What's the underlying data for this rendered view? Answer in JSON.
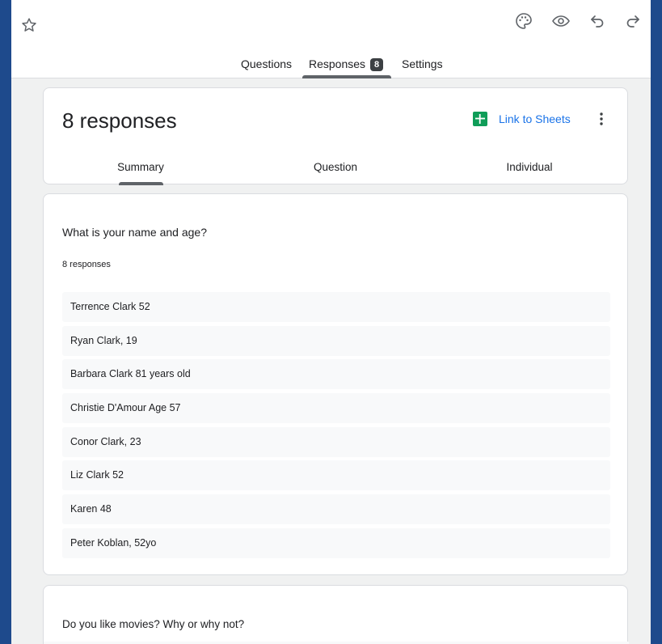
{
  "topbar": {
    "icons": [
      "star-icon",
      "palette-icon",
      "eye-icon",
      "undo-icon",
      "redo-icon"
    ],
    "tabs": [
      {
        "label": "Questions"
      },
      {
        "label": "Responses",
        "badge": "8"
      },
      {
        "label": "Settings"
      }
    ],
    "active_tab": "Responses"
  },
  "summary_header": {
    "response_count_label": "8 responses",
    "link_to_sheets_label": "Link to Sheets",
    "sub_tabs": [
      {
        "label": "Summary"
      },
      {
        "label": "Question"
      },
      {
        "label": "Individual"
      }
    ],
    "active_sub_tab": "Summary"
  },
  "question_1": {
    "title": "What is your name and age?",
    "count_label": "8 responses",
    "responses": [
      "Terrence Clark 52",
      "Ryan Clark, 19",
      "Barbara Clark 81 years old",
      "Christie D'Amour Age 57",
      "Conor Clark, 23",
      "Liz Clark 52",
      "Karen 48",
      "Peter Koblan, 52yo"
    ]
  },
  "question_2": {
    "title": "Do you like movies? Why or why not?"
  },
  "colors": {
    "page_bg": "#f0f1f1",
    "outer_bg": "#1e4a8c",
    "link_blue": "#1a73e8",
    "sheets_green": "#0f9d58",
    "tab_indicator": "#5f6368"
  }
}
